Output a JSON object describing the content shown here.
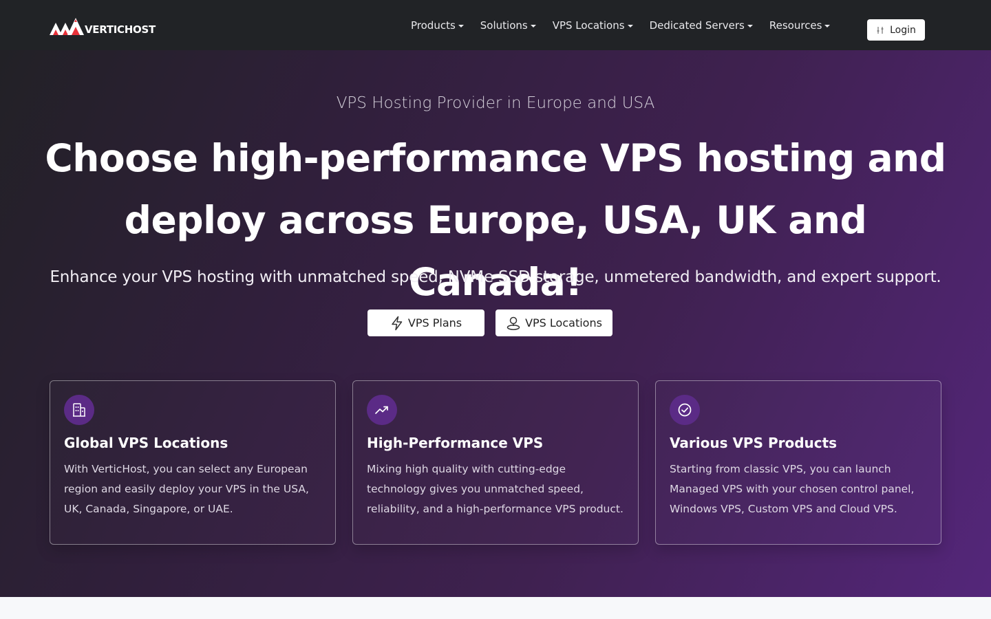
{
  "brand": {
    "logo_text": "VERTICHOST"
  },
  "nav": {
    "items": [
      {
        "label": "Products"
      },
      {
        "label": "Solutions"
      },
      {
        "label": "VPS Locations"
      },
      {
        "label": "Dedicated Servers"
      },
      {
        "label": "Resources"
      }
    ],
    "login_label": "Login"
  },
  "hero": {
    "subtitle": "VPS Hosting Provider in Europe and USA",
    "title_line1": "Choose high-performance VPS hosting and",
    "title_line2": "deploy across Europe, USA, UK and Canada!",
    "description": "Enhance your VPS hosting with unmatched speed, NVMe SSD storage, unmetered bandwidth, and expert support.",
    "buttons": [
      {
        "label": "VPS Plans",
        "icon": "lightning-icon"
      },
      {
        "label": "VPS Locations",
        "icon": "location-pin-icon"
      }
    ]
  },
  "cards": [
    {
      "icon": "building-icon",
      "title": "Global VPS Locations",
      "text": "With VerticHost, you can select any European region and easily deploy your VPS in the USA, UK, Canada, Singapore, or UAE."
    },
    {
      "icon": "trending-up-icon",
      "title": "High-Performance VPS",
      "text": "Mixing high quality with cutting-edge technology gives you unmatched speed, reliability, and a high-performance VPS product."
    },
    {
      "icon": "check-circle-icon",
      "title": "Various VPS Products",
      "text": "Starting from classic VPS, you can launch Managed VPS with your chosen control panel, Windows VPS, Custom VPS and Cloud VPS."
    }
  ],
  "colors": {
    "navbar_bg": "#212326",
    "hero_gradient_start": "#222126",
    "hero_gradient_end": "#54267a",
    "card_icon_bg": "#5b2b86",
    "logo_red": "#e8323a"
  }
}
